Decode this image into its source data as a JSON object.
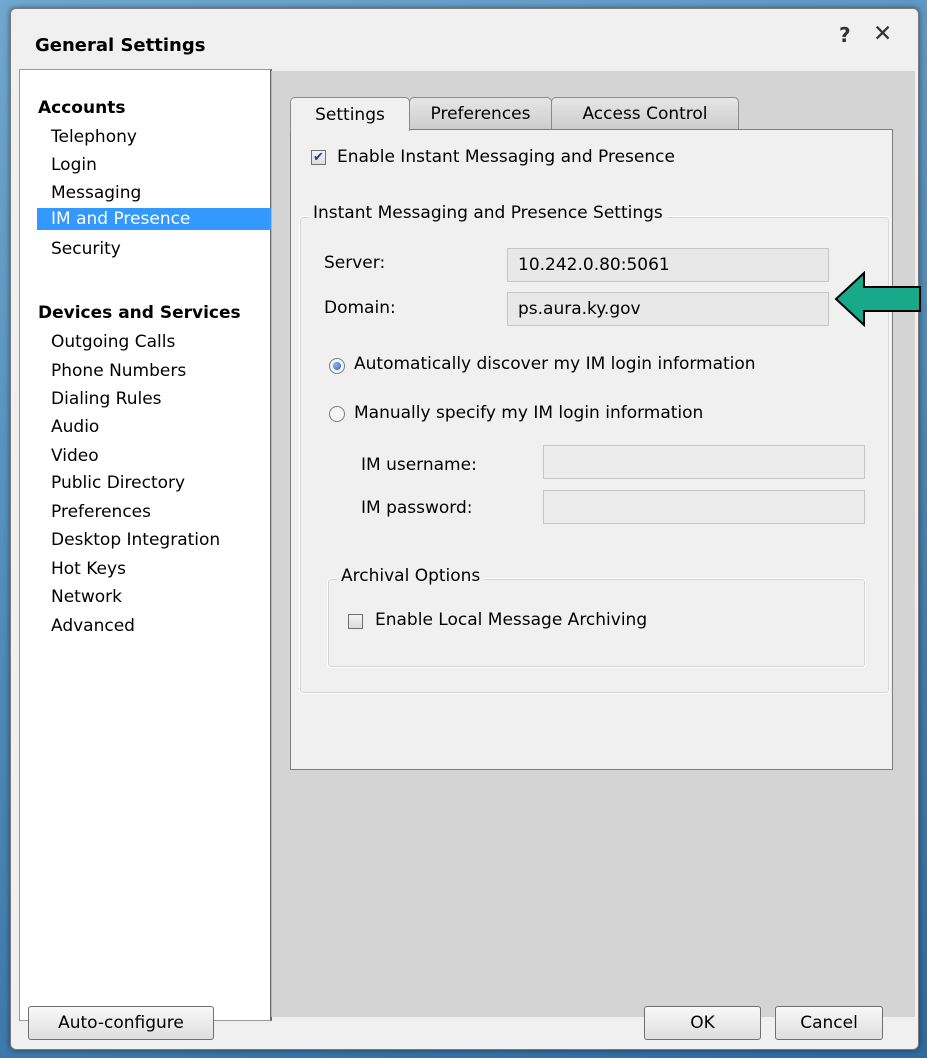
{
  "window": {
    "title": "General Settings",
    "help_label": "?",
    "close_label": "✕"
  },
  "sidebar": {
    "groups": [
      {
        "label": "Accounts",
        "items": [
          "Telephony",
          "Login",
          "Messaging",
          "IM and Presence",
          "Security"
        ]
      },
      {
        "label": "Devices and Services",
        "items": [
          "Outgoing Calls",
          "Phone Numbers",
          "Dialing Rules",
          "Audio",
          "Video",
          "Public Directory",
          "Preferences",
          "Desktop Integration",
          "Hot Keys",
          "Network",
          "Advanced"
        ]
      }
    ],
    "selected": "IM and Presence"
  },
  "tabs": [
    {
      "label": "Settings",
      "active": true
    },
    {
      "label": "Preferences",
      "active": false
    },
    {
      "label": "Access Control",
      "active": false
    }
  ],
  "settings": {
    "enable_im_label": "Enable Instant Messaging and Presence",
    "enable_im_checked": true,
    "group_title": "Instant Messaging and Presence Settings",
    "server_label": "Server:",
    "server_value": "10.242.0.80:5061",
    "domain_label": "Domain:",
    "domain_value": "ps.aura.ky.gov",
    "auto_discover_label": "Automatically discover my IM login information",
    "manual_label": "Manually specify my IM login information",
    "login_mode": "auto",
    "im_username_label": "IM username:",
    "im_username_value": "",
    "im_password_label": "IM password:",
    "im_password_value": "",
    "archival_title": "Archival Options",
    "archiving_label": "Enable Local Message Archiving",
    "archiving_checked": false
  },
  "buttons": {
    "auto_configure": "Auto-configure",
    "ok": "OK",
    "cancel": "Cancel"
  },
  "annotation": {
    "arrow_color": "#18a88a",
    "arrow_icon": "left-arrow-icon"
  }
}
